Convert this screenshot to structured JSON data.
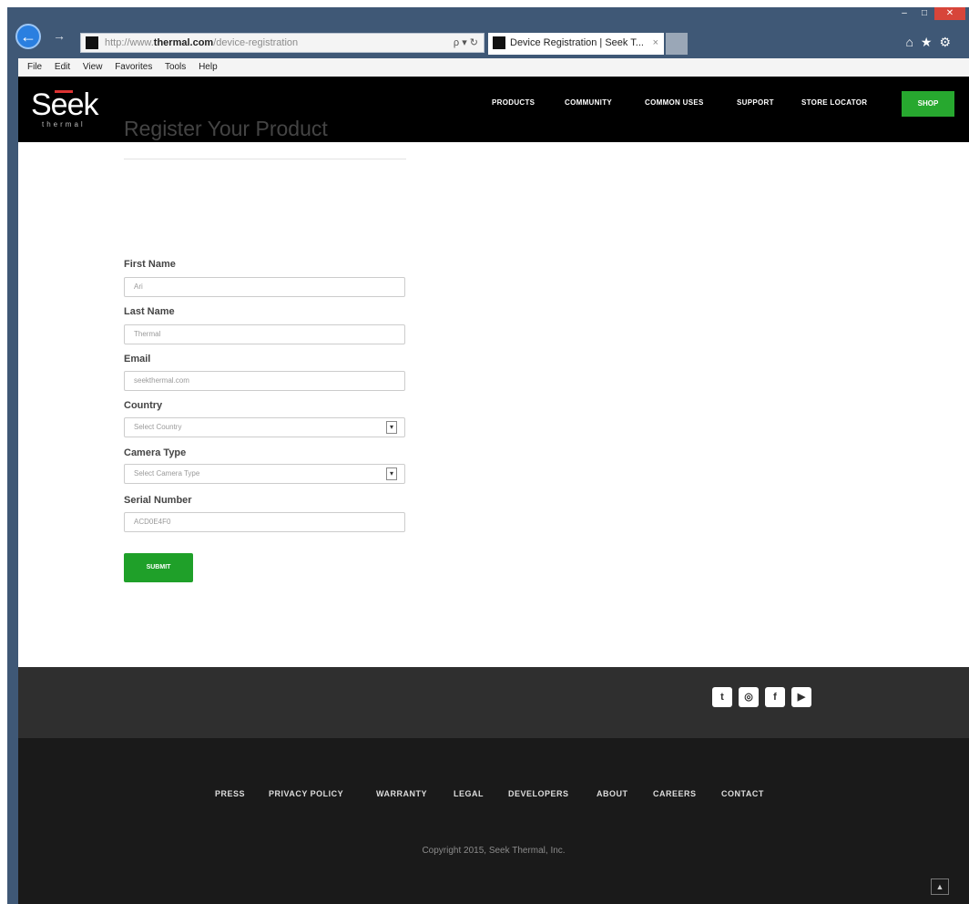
{
  "browser": {
    "url_prefix": "http://www.",
    "url_domain": "thermal.com",
    "url_path": "/device-registration",
    "url_controls": "ρ ▾ ↻",
    "tab_title": "Device Registration | Seek T...",
    "tab_close": "×",
    "back": "←",
    "forward": "→",
    "window_controls": [
      "–",
      "□",
      "✕"
    ],
    "right_icons": "⌂★⚙",
    "menu": [
      "File",
      "Edit",
      "View",
      "Favorites",
      "Tools",
      "Help"
    ]
  },
  "header": {
    "logo": "Seek",
    "logo_sub": "thermal",
    "nav": [
      "PRODUCTS",
      "COMMUNITY",
      "COMMON USES",
      "SUPPORT",
      "STORE LOCATOR"
    ],
    "shop": "SHOP"
  },
  "form": {
    "title": "Register Your Product",
    "first_name_label": "First Name",
    "first_name_value": "Ari",
    "last_name_label": "Last Name",
    "last_name_value": "Thermal",
    "email_label": "Email",
    "email_value": "seekthermal.com",
    "country_label": "Country",
    "country_value": "Select Country",
    "camera_label": "Camera Type",
    "camera_value": "Select Camera Type",
    "serial_label": "Serial Number",
    "serial_value": "ACD0E4F0",
    "submit": "SUBMIT",
    "select_arrow": "▾"
  },
  "footer": {
    "social": [
      "t",
      "◎",
      "f",
      "▶"
    ],
    "links": [
      "PRESS",
      "PRIVACY POLICY",
      "WARRANTY",
      "LEGAL",
      "DEVELOPERS",
      "ABOUT",
      "CAREERS",
      "CONTACT"
    ],
    "copyright": "Copyright 2015, Seek Thermal, Inc.",
    "scroll_top": "▲"
  },
  "colors": {
    "brand_green": "#1fa029",
    "nav_bg": "#000000",
    "footer_top": "#2f2f2f",
    "footer_bottom": "#1a1a1a",
    "browser_chrome": "#3f5876"
  }
}
